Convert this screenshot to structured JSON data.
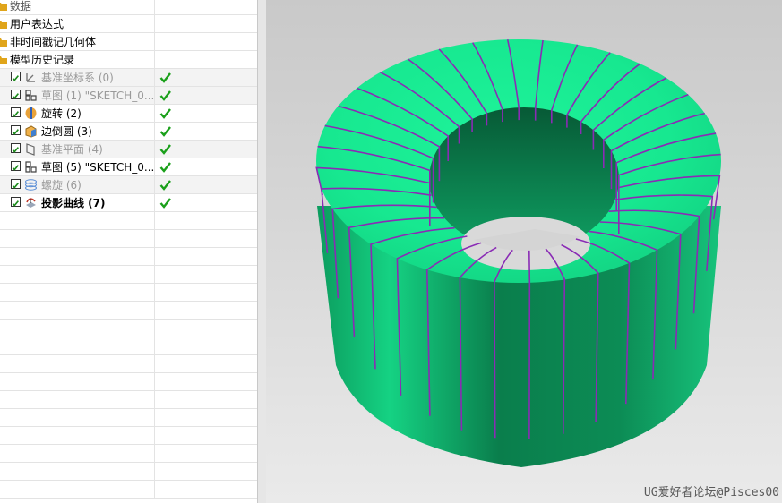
{
  "navigator": {
    "top_partial": "数据",
    "sections": [
      {
        "label": "用户表达式"
      },
      {
        "label": "非时间戳记几何体"
      },
      {
        "label": "模型历史记录"
      }
    ],
    "features": [
      {
        "label": "基准坐标系 (0)",
        "icon": "datum-csys-icon",
        "checked": true,
        "status": "check-icon",
        "suppressed": true
      },
      {
        "label": "草图 (1) \"SKETCH_0...",
        "icon": "sketch-icon",
        "checked": true,
        "status": "check-icon",
        "suppressed": true
      },
      {
        "label": "旋转 (2)",
        "icon": "revolve-icon",
        "checked": true,
        "status": "check-icon"
      },
      {
        "label": "边倒圆 (3)",
        "icon": "edge-blend-icon",
        "checked": true,
        "status": "check-icon"
      },
      {
        "label": "基准平面 (4)",
        "icon": "datum-plane-icon",
        "checked": true,
        "status": "check-icon",
        "suppressed": true
      },
      {
        "label": "草图 (5) \"SKETCH_0...",
        "icon": "sketch-icon",
        "checked": true,
        "status": "check-icon"
      },
      {
        "label": "螺旋 (6)",
        "icon": "helix-icon",
        "checked": true,
        "status": "check-icon",
        "suppressed": true
      },
      {
        "label": "投影曲线 (7)",
        "icon": "project-curve-icon",
        "checked": true,
        "status": "check-icon",
        "bold": true
      }
    ]
  },
  "viewport": {
    "watermark": "UG爱好者论坛@Pisces00",
    "model_color": "#17e890",
    "curve_color": "#8a2bb5"
  }
}
